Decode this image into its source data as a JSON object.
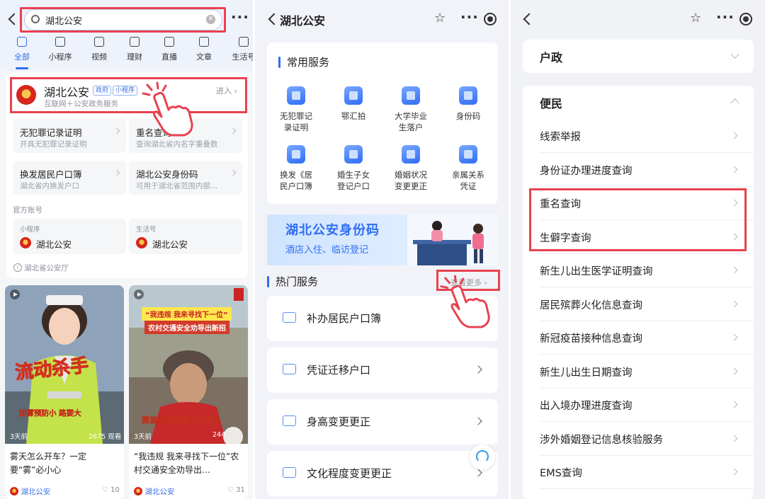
{
  "panel1": {
    "search": {
      "query": "湖北公安"
    },
    "categories": [
      {
        "label": "全部",
        "icon": "grid-icon"
      },
      {
        "label": "小程序",
        "icon": "miniapp-icon"
      },
      {
        "label": "视频",
        "icon": "video-icon"
      },
      {
        "label": "理财",
        "icon": "finance-icon"
      },
      {
        "label": "直播",
        "icon": "tv-icon"
      },
      {
        "label": "文章",
        "icon": "article-icon"
      },
      {
        "label": "生活号",
        "icon": "life-icon"
      }
    ],
    "result": {
      "title": "湖北公安",
      "tags": [
        "政府",
        "小程序"
      ],
      "subtitle": "互联网＋公安政务服务",
      "enter_label": "进入"
    },
    "services": [
      {
        "title": "无犯罪记录证明",
        "desc": "开具无犯罪记录证明"
      },
      {
        "title": "重名查询",
        "desc": "查询湖北省内名字重叠数"
      },
      {
        "title": "换发居民户口簿",
        "desc": "湖北省内换发户口"
      },
      {
        "title": "湖北公安身份码",
        "desc": "可用于湖北省范围内部…"
      }
    ],
    "official_label": "官方账号",
    "accounts": [
      {
        "kind": "小程序",
        "name": "湖北公安"
      },
      {
        "kind": "生活号",
        "name": "湖北公安"
      }
    ],
    "source_note": "湖北省公安厅",
    "videos": [
      {
        "age": "3天前",
        "views": "2675 观看",
        "title": "雾天怎么开车？一定要“雾”必小心",
        "author": "湖北公安",
        "likes": "10",
        "overlay": "流动杀手",
        "overlay2": "团雾预防小 路要大"
      },
      {
        "age": "3天前",
        "views": "244",
        "title": "“我违规 我来寻找下一位”农村交通安全劝导出…",
        "author": "湖北公安",
        "likes": "31",
        "overlay": "“我违规 我来寻找下一位”",
        "overlay2": "农村交通安全劝导出新招",
        "overlay3": "我皆回都走出来了才带"
      }
    ]
  },
  "panel2": {
    "nav_title": "湖北公安",
    "common_title": "常用服务",
    "common_services": [
      {
        "label": "无犯罪记\n录证明"
      },
      {
        "label": "鄂汇拍"
      },
      {
        "label": "大学毕业\n生落户"
      },
      {
        "label": "身份码"
      },
      {
        "label": "换发《居\n民户口簿"
      },
      {
        "label": "婚生子女\n登记户口"
      },
      {
        "label": "婚姻状况\n变更更正"
      },
      {
        "label": "亲属关系\n凭证"
      }
    ],
    "banner": {
      "title": "湖北公安身份码",
      "subtitle": "酒店入住、临访登记"
    },
    "hot_title": "热门服务",
    "see_more": "查看更多",
    "hot_services": [
      {
        "label": "补办居民户口簿"
      },
      {
        "label": "凭证迁移户口"
      },
      {
        "label": "身高变更更正"
      },
      {
        "label": "文化程度变更更正"
      }
    ]
  },
  "panel3": {
    "group1": "户政",
    "group2": "便民",
    "items": [
      {
        "label": "线索举报"
      },
      {
        "label": "身份证办理进度查询"
      },
      {
        "label": "重名查询"
      },
      {
        "label": "生僻字查询"
      },
      {
        "label": "新生儿出生医学证明查询"
      },
      {
        "label": "居民殡葬火化信息查询"
      },
      {
        "label": "新冠疫苗接种信息查询"
      },
      {
        "label": "新生儿出生日期查询"
      },
      {
        "label": "出入境办理进度查询"
      },
      {
        "label": "涉外婚姻登记信息核验服务"
      },
      {
        "label": "EMS查询"
      }
    ]
  },
  "colors": {
    "accent": "#2f6df5",
    "highlight_frame": "#e8424e"
  }
}
